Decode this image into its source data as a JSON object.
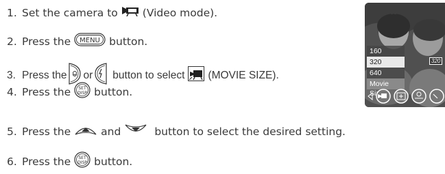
{
  "steps": [
    {
      "num": "1.",
      "before": "Set the camera to",
      "after": "(Video mode)."
    },
    {
      "num": "2.",
      "before": "Press the",
      "after": "button."
    },
    {
      "num": "3.",
      "before": "Press the",
      "mid": "or",
      "after": "button to select",
      "after2": "(MOVIE SIZE)."
    },
    {
      "num": "4.",
      "before": "Press the",
      "after": "button."
    },
    {
      "num": "5.",
      "before": "Press the",
      "mid": "and",
      "after": "button to select the desired setting."
    },
    {
      "num": "6.",
      "before": "Press the",
      "after": "button."
    }
  ],
  "icons": {
    "menu_button": "MENU",
    "set_disp_top": "SET",
    "set_disp_bottom": "DISP"
  },
  "lcd": {
    "options": [
      "160",
      "320",
      "640"
    ],
    "selected": "320",
    "caption": "Movie Size",
    "size_chip": "320",
    "bottom_icons": [
      "left-arrow-icon",
      "movie-size-icon",
      "exposure-icon",
      "white-balance-icon",
      "next-icon"
    ]
  },
  "colors": {
    "text": "#3a3a3a",
    "icon_stroke": "#333333"
  }
}
